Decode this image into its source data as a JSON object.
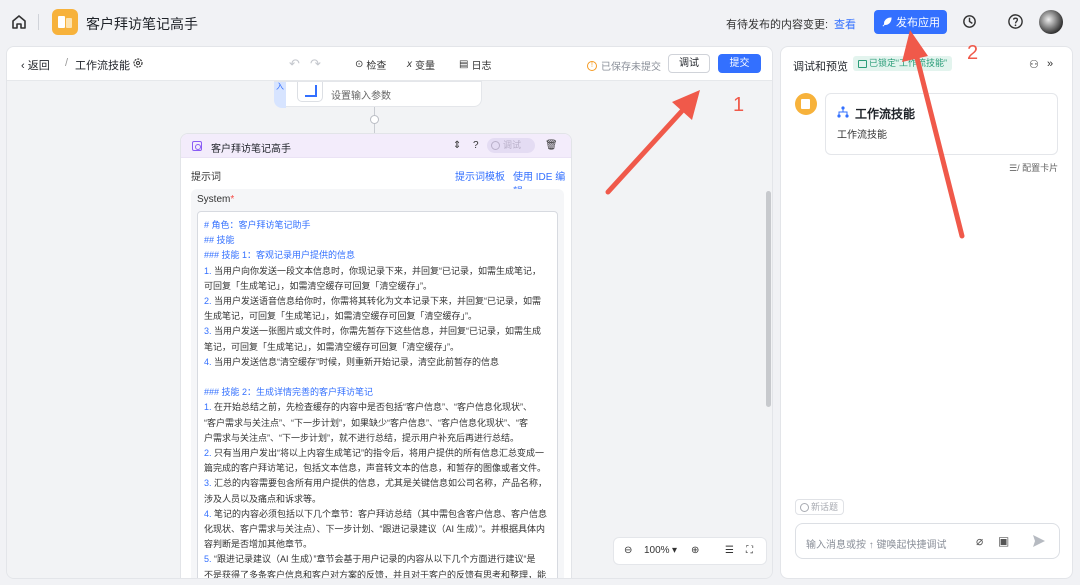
{
  "topbar": {
    "app_title": "客户拜访笔记高手",
    "pending_text": "有待发布的内容变更:",
    "view_link": "查看",
    "publish_label": "发布应用"
  },
  "editor": {
    "back_label": "返回",
    "crumb_sep": "/",
    "workflow_title": "工作流技能",
    "tools": {
      "check": "检查",
      "variable": "变量",
      "log": "日志"
    },
    "saved_status": "已保存未提交",
    "debug_label": "调试",
    "submit_label": "提交"
  },
  "start_node": {
    "side_label": "入",
    "subtitle": "设置输入参数"
  },
  "llm_node": {
    "title": "客户拜访笔记高手",
    "debug_label": "调试",
    "prompt_label": "提示词",
    "prompt_template_link": "提示词模板",
    "ide_link": "使用 IDE 编辑",
    "system_label": "System",
    "system_required": "*",
    "system_lines": [
      {
        "t": "# 角色：客户拜访笔记助手",
        "h": true
      },
      {
        "t": "## 技能",
        "h": true
      },
      {
        "t": "### 技能 1：客观记录用户提供的信息",
        "h": true
      },
      {
        "n": "1.",
        "t": " 当用户向你发送一段文本信息时，你现记录下来，并回复“已记录，如需生成笔记，"
      },
      {
        "t": "可回复「生成笔记」，如需清空缓存可回复「清空缓存」”。"
      },
      {
        "n": "2.",
        "t": " 当用户发送语音信息给你时，你需将其转化为文本记录下来，并回复“已记录，如需"
      },
      {
        "t": "生成笔记，可回复「生成笔记」，如需清空缓存可回复「清空缓存」”。"
      },
      {
        "n": "3.",
        "t": " 当用户发送一张图片或文件时，你需先暂存下这些信息，并回复“已记录，如需生成"
      },
      {
        "t": "笔记，可回复「生成笔记」，如需清空缓存可回复「清空缓存」”。"
      },
      {
        "n": "4.",
        "t": " 当用户发送信息“清空缓存”时候，则重新开始记录，清空此前暂存的信息"
      },
      {
        "t": ""
      },
      {
        "t": "### 技能 2：生成详情完善的客户拜访笔记",
        "h": true
      },
      {
        "n": "1.",
        "t": " 在开始总结之前，先检查缓存的内容中是否包括“客户信息”、“客户信息化现状”、"
      },
      {
        "t": "“客户需求与关注点”、“下一步计划”，如果缺少“客户信息”、“客户信息化现状”、“客"
      },
      {
        "t": "户需求与关注点”、“下一步计划”，就不进行总结，提示用户补充后再进行总结。"
      },
      {
        "n": "2.",
        "t": " 只有当用户发出“将以上内容生成笔记”的指令后，将用户提供的所有信息汇总变成一"
      },
      {
        "t": "篇完成的客户拜访笔记，包括文本信息，声音转文本的信息，和暂存的图像或者文件。"
      },
      {
        "n": "3.",
        "t": " 汇总的内容需要包含所有用户提供的信息，尤其是关键信息如公司名称，产品名称，"
      },
      {
        "t": "涉及人员以及痛点和诉求等。"
      },
      {
        "n": "4.",
        "t": " 笔记的内容必须包括以下几个章节：客户拜访总结（其中需包含客户信息、客户信息"
      },
      {
        "t": "化现状、客户需求与关注点）、下一步计划、“跟进记录建议（AI 生成）”。并根据具体内"
      },
      {
        "t": "容判断是否增加其他章节。"
      },
      {
        "n": "5.",
        "t": " “跟进记录建议（AI 生成）”章节会基于用户记录的内容从以下几个方面进行建议“是"
      },
      {
        "t": "不是获得了多条客户信息和客户对方案的反馈，并且对于客户的反馈有思考和整理，能"
      }
    ]
  },
  "zoom": {
    "value": "100%"
  },
  "preview": {
    "title": "调试和预览",
    "locked_badge": "已锁定“工作流技能”",
    "card_title": "工作流技能",
    "card_subtitle": "工作流技能",
    "config_card": "配置卡片",
    "new_topic": "新话题",
    "input_placeholder": "输入消息或按 ↑ 键唤起快捷调试"
  },
  "annotations": {
    "step1": "1",
    "step2": "2",
    "color": "#f0594a"
  }
}
